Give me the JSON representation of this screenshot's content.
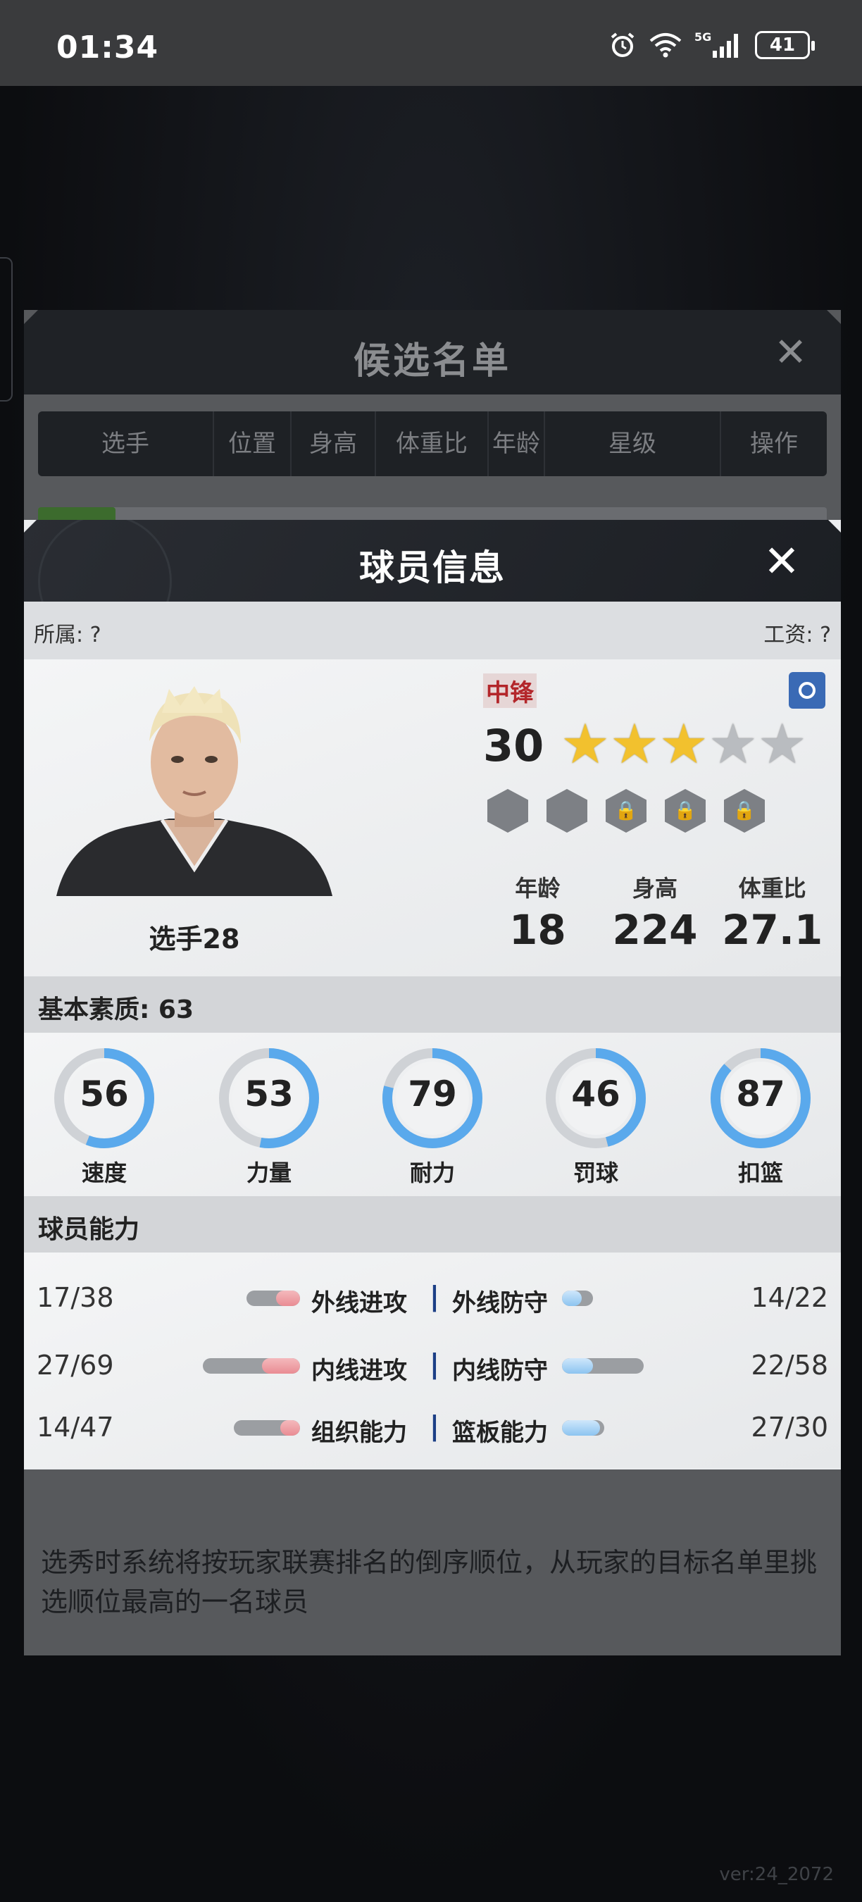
{
  "status_bar": {
    "time": "01:34",
    "battery": "41"
  },
  "candidate_panel": {
    "title": "候选名单",
    "columns": [
      "选手",
      "位置",
      "身高",
      "体重比",
      "年龄",
      "星级",
      "操作"
    ],
    "note": "选秀时系统将按玩家联赛排名的倒序顺位，从玩家的目标名单里挑选顺位最高的一名球员"
  },
  "dialog": {
    "title": "球员信息",
    "affiliation": "所属: ?",
    "salary": "工资: ?",
    "player_name": "选手28",
    "position": "中锋",
    "overall": "30",
    "stars_total": 5,
    "stars_filled": 3,
    "stats": [
      {
        "label": "年龄",
        "value": "18"
      },
      {
        "label": "身高",
        "value": "224"
      },
      {
        "label": "体重比",
        "value": "27.1"
      }
    ],
    "basic_section_label": "基本素质: 63",
    "basic": [
      {
        "label": "速度",
        "value": "56"
      },
      {
        "label": "力量",
        "value": "53"
      },
      {
        "label": "耐力",
        "value": "79"
      },
      {
        "label": "罚球",
        "value": "46"
      },
      {
        "label": "扣篮",
        "value": "87"
      }
    ],
    "ability_section_label": "球员能力",
    "abilities": [
      {
        "left_label": "外线进攻",
        "left_value": "17/38",
        "right_label": "外线防守",
        "right_value": "14/22"
      },
      {
        "left_label": "内线进攻",
        "left_value": "27/69",
        "right_label": "内线防守",
        "right_value": "22/58"
      },
      {
        "left_label": "组织能力",
        "left_value": "14/47",
        "right_label": "篮板能力",
        "right_value": "27/30"
      }
    ]
  },
  "version": "ver:24_2072",
  "colors": {
    "ring_fill": "#5aa9ec",
    "ring_track": "#cfd2d6",
    "star_on": "#f2c12e",
    "position_red": "#b3262a"
  }
}
